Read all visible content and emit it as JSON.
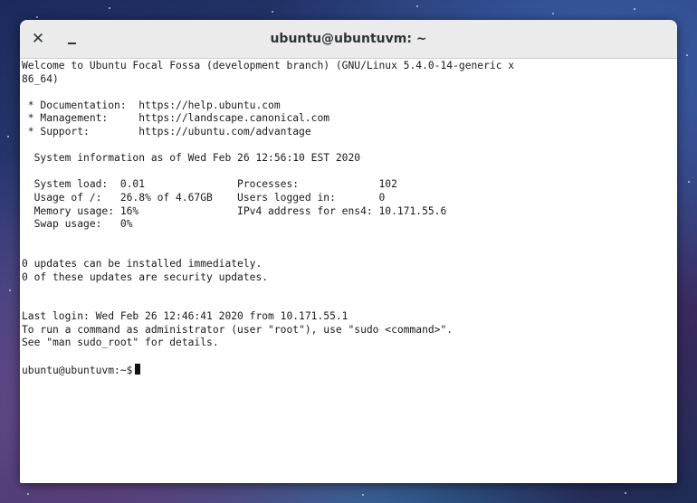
{
  "window": {
    "title": "ubuntu@ubuntuvm: ~",
    "close_glyph": "✕",
    "minimize_glyph": "_"
  },
  "terminal": {
    "lines": [
      "Welcome to Ubuntu Focal Fossa (development branch) (GNU/Linux 5.4.0-14-generic x",
      "86_64)",
      "",
      " * Documentation:  https://help.ubuntu.com",
      " * Management:     https://landscape.canonical.com",
      " * Support:        https://ubuntu.com/advantage",
      "",
      "  System information as of Wed Feb 26 12:56:10 EST 2020",
      "",
      "  System load:  0.01               Processes:             102",
      "  Usage of /:   26.8% of 4.67GB    Users logged in:       0",
      "  Memory usage: 16%                IPv4 address for ens4: 10.171.55.6",
      "  Swap usage:   0%",
      "",
      "",
      "0 updates can be installed immediately.",
      "0 of these updates are security updates.",
      "",
      "",
      "Last login: Wed Feb 26 12:46:41 2020 from 10.171.55.1",
      "To run a command as administrator (user \"root\"), use \"sudo <command>\".",
      "See \"man sudo_root\" for details.",
      ""
    ],
    "prompt": "ubuntu@ubuntuvm:~$ "
  },
  "colors": {
    "titlebar_bg": "#ebebeb",
    "terminal_bg": "#ffffff",
    "terminal_fg": "#1a1a1a"
  }
}
